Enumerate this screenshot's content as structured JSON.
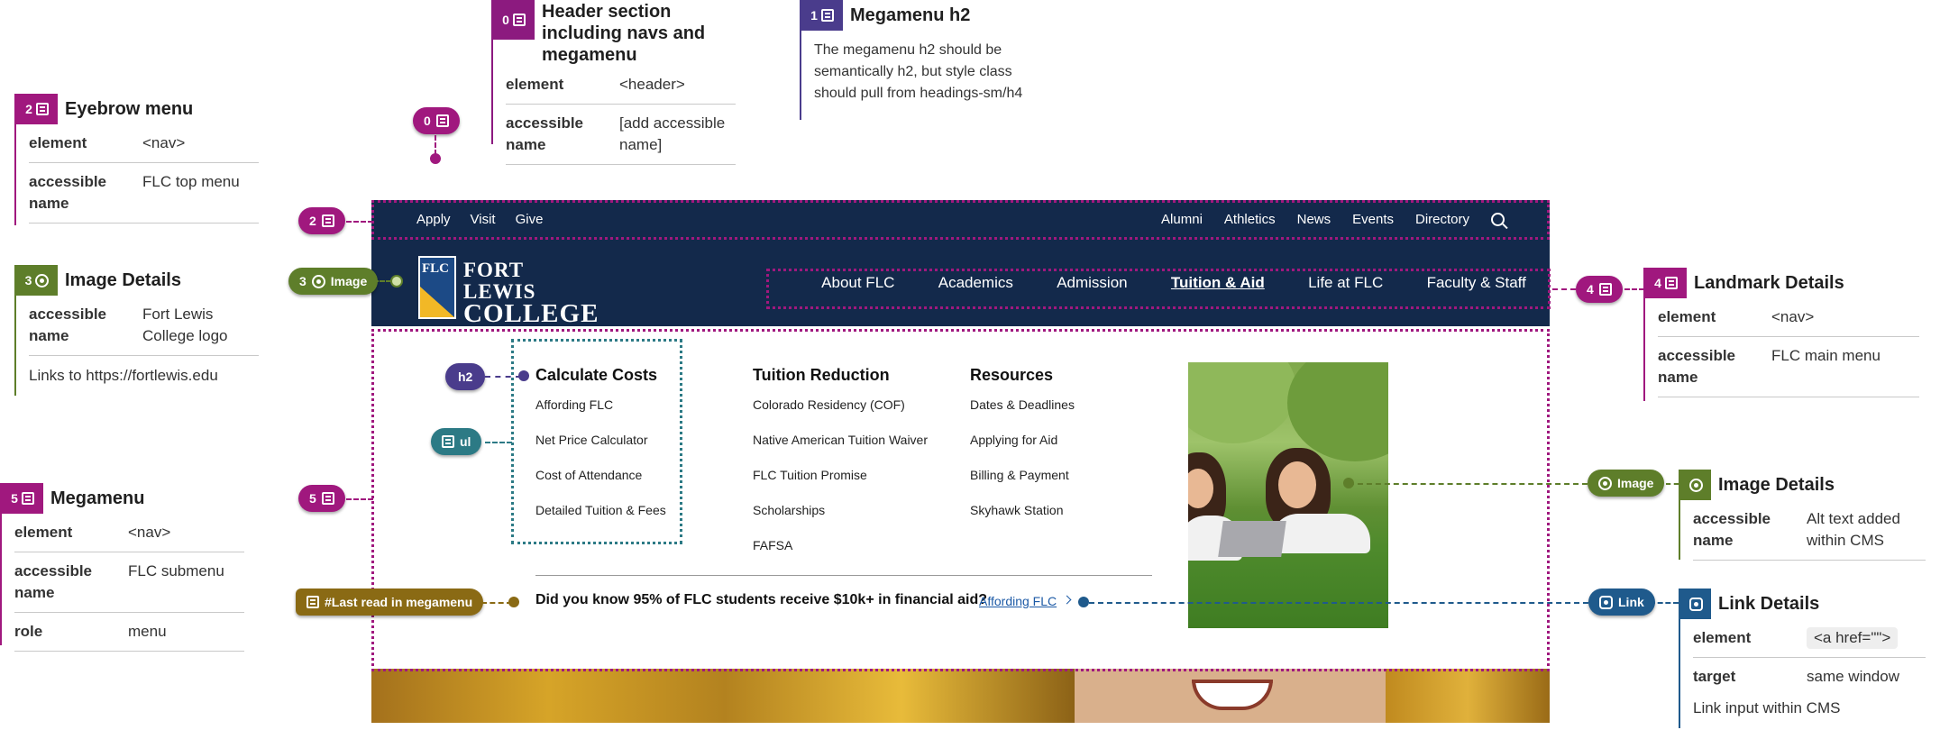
{
  "colors": {
    "header": "#8c1a7f",
    "megamenu_h2": "#4a3c8c",
    "eyebrow": "#a0187e",
    "image": "#5e7e2a",
    "landmark": "#a0187e",
    "megamenu": "#a0187e",
    "h2_marker": "#4a3c8c",
    "ul_marker": "#2c7a85",
    "image_right": "#5e7e2a",
    "link": "#1f5a8c",
    "last_read": "#8a6a14",
    "site_navy": "#13294b"
  },
  "cards": {
    "header": {
      "badge": "0",
      "icon": "layout-icon",
      "title": "Header section including navs and megamenu",
      "rows": [
        {
          "key": "element",
          "value": "<header>"
        },
        {
          "key": "accessible name",
          "value": "[add accessible name]"
        }
      ]
    },
    "megamenu_h2": {
      "badge": "1",
      "icon": "heading-icon",
      "title": "Megamenu h2",
      "note": "The megamenu h2 should be semantically h2, but style class should pull from headings-sm/h4"
    },
    "eyebrow": {
      "badge": "2",
      "icon": "layout-icon",
      "title": "Eyebrow menu",
      "rows": [
        {
          "key": "element",
          "value": "<nav>"
        },
        {
          "key": "accessible name",
          "value": "FLC top menu"
        }
      ]
    },
    "image_logo": {
      "badge": "3",
      "icon": "image-icon",
      "title": "Image Details",
      "rows": [
        {
          "key": "accessible name",
          "value": "Fort Lewis College logo"
        }
      ],
      "note": "Links to https://fortlewis.edu"
    },
    "landmark": {
      "badge": "4",
      "icon": "layout-icon",
      "title": "Landmark Details",
      "rows": [
        {
          "key": "element",
          "value": "<nav>"
        },
        {
          "key": "accessible name",
          "value": "FLC main menu"
        }
      ]
    },
    "megamenu": {
      "badge": "5",
      "icon": "layout-icon",
      "title": "Megamenu",
      "rows": [
        {
          "key": "element",
          "value": "<nav>"
        },
        {
          "key": "accessible name",
          "value": "FLC submenu"
        },
        {
          "key": "role",
          "value": "menu"
        }
      ]
    },
    "image_photo": {
      "icon": "image-icon",
      "title": "Image Details",
      "rows": [
        {
          "key": "accessible name",
          "value": "Alt text added within CMS"
        }
      ]
    },
    "link": {
      "icon": "link-icon",
      "title": "Link Details",
      "rows": [
        {
          "key": "element",
          "value": "<a href=\"\">"
        },
        {
          "key": "target",
          "value": "same window"
        }
      ],
      "note": "Link input within CMS"
    }
  },
  "markers": {
    "m0": "0",
    "m2": "2",
    "m3": "3",
    "m3_label": "Image",
    "m4": "4",
    "m5": "5",
    "h2": "h2",
    "ul": "ul",
    "image_right": "Image",
    "link": "Link",
    "last_read": "#Last read in megamenu"
  },
  "site": {
    "eyebrow_left": [
      "Apply",
      "Visit",
      "Give"
    ],
    "eyebrow_right": [
      "Alumni",
      "Athletics",
      "News",
      "Events",
      "Directory"
    ],
    "logo": {
      "mark": "FLC",
      "line1": "FORT LEWIS",
      "line2": "COLLEGE"
    },
    "main_nav": [
      "About FLC",
      "Academics",
      "Admission",
      "Tuition & Aid",
      "Life at FLC",
      "Faculty & Staff"
    ],
    "active_nav": "Tuition & Aid",
    "megamenu": {
      "columns": [
        {
          "heading": "Calculate Costs",
          "items": [
            "Affording FLC",
            "Net Price Calculator",
            "Cost of Attendance",
            "Detailed Tuition & Fees"
          ]
        },
        {
          "heading": "Tuition Reduction",
          "items": [
            "Colorado Residency (COF)",
            "Native American Tuition Waiver",
            "FLC Tuition Promise",
            "Scholarships",
            "FAFSA"
          ]
        },
        {
          "heading": "Resources",
          "items": [
            "Dates & Deadlines",
            "Applying for Aid",
            "Billing & Payment",
            "Skyhawk Station"
          ]
        }
      ],
      "did_you_know": "Did you know 95% of FLC students receive $10k+ in financial aid?",
      "did_you_know_link": "Affording FLC"
    }
  }
}
